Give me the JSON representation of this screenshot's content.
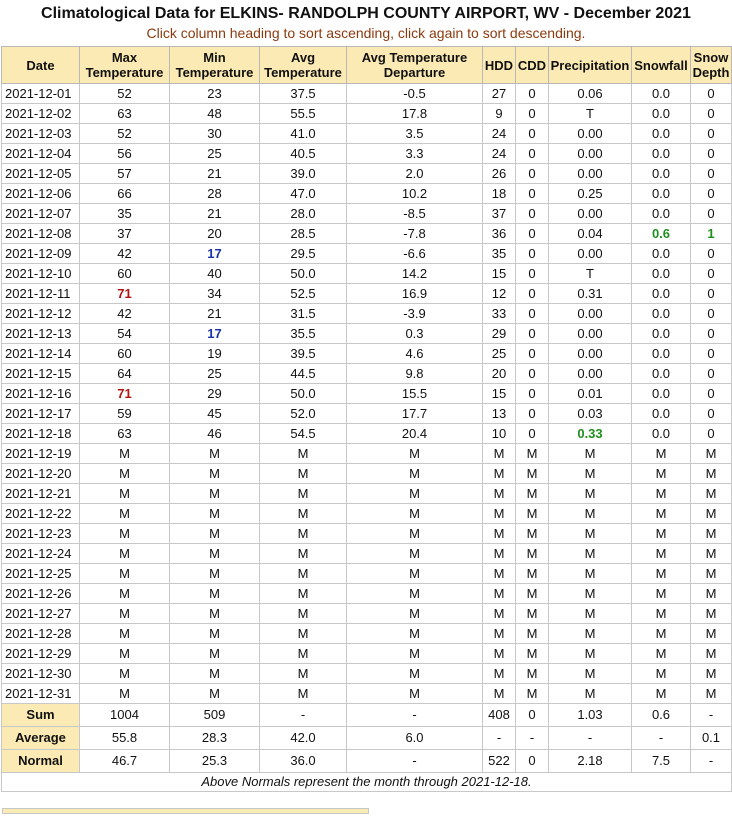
{
  "title": "Climatological Data for ELKINS- RANDOLPH COUNTY AIRPORT, WV - December 2021",
  "subtitle": "Click column heading to sort ascending, click again to sort descending.",
  "headers": [
    "Date",
    "Max Temperature",
    "Min Temperature",
    "Avg Temperature",
    "Avg Temperature Departure",
    "HDD",
    "CDD",
    "Precipitation",
    "Snowfall",
    "Snow Depth"
  ],
  "colors": {
    "header_bg": "#fbeab3",
    "record_high": "#b11414",
    "record_low": "#1a33a8",
    "precip_snow_max": "#1f8f1f",
    "subtitle": "#8b3a0e"
  },
  "rows": [
    [
      "2021-12-01",
      "52",
      "23",
      "37.5",
      "-0.5",
      "27",
      "0",
      "0.06",
      "0.0",
      "0"
    ],
    [
      "2021-12-02",
      "63",
      "48",
      "55.5",
      "17.8",
      "9",
      "0",
      "T",
      "0.0",
      "0"
    ],
    [
      "2021-12-03",
      "52",
      "30",
      "41.0",
      "3.5",
      "24",
      "0",
      "0.00",
      "0.0",
      "0"
    ],
    [
      "2021-12-04",
      "56",
      "25",
      "40.5",
      "3.3",
      "24",
      "0",
      "0.00",
      "0.0",
      "0"
    ],
    [
      "2021-12-05",
      "57",
      "21",
      "39.0",
      "2.0",
      "26",
      "0",
      "0.00",
      "0.0",
      "0"
    ],
    [
      "2021-12-06",
      "66",
      "28",
      "47.0",
      "10.2",
      "18",
      "0",
      "0.25",
      "0.0",
      "0"
    ],
    [
      "2021-12-07",
      "35",
      "21",
      "28.0",
      "-8.5",
      "37",
      "0",
      "0.00",
      "0.0",
      "0"
    ],
    [
      "2021-12-08",
      "37",
      "20",
      "28.5",
      "-7.8",
      "36",
      "0",
      "0.04",
      "0.6",
      "1"
    ],
    [
      "2021-12-09",
      "42",
      "17",
      "29.5",
      "-6.6",
      "35",
      "0",
      "0.00",
      "0.0",
      "0"
    ],
    [
      "2021-12-10",
      "60",
      "40",
      "50.0",
      "14.2",
      "15",
      "0",
      "T",
      "0.0",
      "0"
    ],
    [
      "2021-12-11",
      "71",
      "34",
      "52.5",
      "16.9",
      "12",
      "0",
      "0.31",
      "0.0",
      "0"
    ],
    [
      "2021-12-12",
      "42",
      "21",
      "31.5",
      "-3.9",
      "33",
      "0",
      "0.00",
      "0.0",
      "0"
    ],
    [
      "2021-12-13",
      "54",
      "17",
      "35.5",
      "0.3",
      "29",
      "0",
      "0.00",
      "0.0",
      "0"
    ],
    [
      "2021-12-14",
      "60",
      "19",
      "39.5",
      "4.6",
      "25",
      "0",
      "0.00",
      "0.0",
      "0"
    ],
    [
      "2021-12-15",
      "64",
      "25",
      "44.5",
      "9.8",
      "20",
      "0",
      "0.00",
      "0.0",
      "0"
    ],
    [
      "2021-12-16",
      "71",
      "29",
      "50.0",
      "15.5",
      "15",
      "0",
      "0.01",
      "0.0",
      "0"
    ],
    [
      "2021-12-17",
      "59",
      "45",
      "52.0",
      "17.7",
      "13",
      "0",
      "0.03",
      "0.0",
      "0"
    ],
    [
      "2021-12-18",
      "63",
      "46",
      "54.5",
      "20.4",
      "10",
      "0",
      "0.33",
      "0.0",
      "0"
    ],
    [
      "2021-12-19",
      "M",
      "M",
      "M",
      "M",
      "M",
      "M",
      "M",
      "M",
      "M"
    ],
    [
      "2021-12-20",
      "M",
      "M",
      "M",
      "M",
      "M",
      "M",
      "M",
      "M",
      "M"
    ],
    [
      "2021-12-21",
      "M",
      "M",
      "M",
      "M",
      "M",
      "M",
      "M",
      "M",
      "M"
    ],
    [
      "2021-12-22",
      "M",
      "M",
      "M",
      "M",
      "M",
      "M",
      "M",
      "M",
      "M"
    ],
    [
      "2021-12-23",
      "M",
      "M",
      "M",
      "M",
      "M",
      "M",
      "M",
      "M",
      "M"
    ],
    [
      "2021-12-24",
      "M",
      "M",
      "M",
      "M",
      "M",
      "M",
      "M",
      "M",
      "M"
    ],
    [
      "2021-12-25",
      "M",
      "M",
      "M",
      "M",
      "M",
      "M",
      "M",
      "M",
      "M"
    ],
    [
      "2021-12-26",
      "M",
      "M",
      "M",
      "M",
      "M",
      "M",
      "M",
      "M",
      "M"
    ],
    [
      "2021-12-27",
      "M",
      "M",
      "M",
      "M",
      "M",
      "M",
      "M",
      "M",
      "M"
    ],
    [
      "2021-12-28",
      "M",
      "M",
      "M",
      "M",
      "M",
      "M",
      "M",
      "M",
      "M"
    ],
    [
      "2021-12-29",
      "M",
      "M",
      "M",
      "M",
      "M",
      "M",
      "M",
      "M",
      "M"
    ],
    [
      "2021-12-30",
      "M",
      "M",
      "M",
      "M",
      "M",
      "M",
      "M",
      "M",
      "M"
    ],
    [
      "2021-12-31",
      "M",
      "M",
      "M",
      "M",
      "M",
      "M",
      "M",
      "M",
      "M"
    ]
  ],
  "highlights": {
    "hot": [
      [
        10,
        1
      ],
      [
        15,
        1
      ]
    ],
    "cold": [
      [
        8,
        2
      ],
      [
        12,
        2
      ]
    ],
    "green": [
      [
        7,
        8
      ],
      [
        7,
        9
      ],
      [
        17,
        7
      ]
    ]
  },
  "summary": [
    [
      "Sum",
      "1004",
      "509",
      "-",
      "-",
      "408",
      "0",
      "1.03",
      "0.6",
      "-"
    ],
    [
      "Average",
      "55.8",
      "28.3",
      "42.0",
      "6.0",
      "-",
      "-",
      "-",
      "-",
      "0.1"
    ],
    [
      "Normal",
      "46.7",
      "25.3",
      "36.0",
      "-",
      "522",
      "0",
      "2.18",
      "7.5",
      "-"
    ]
  ],
  "footnote": "Above Normals represent the month through 2021-12-18."
}
